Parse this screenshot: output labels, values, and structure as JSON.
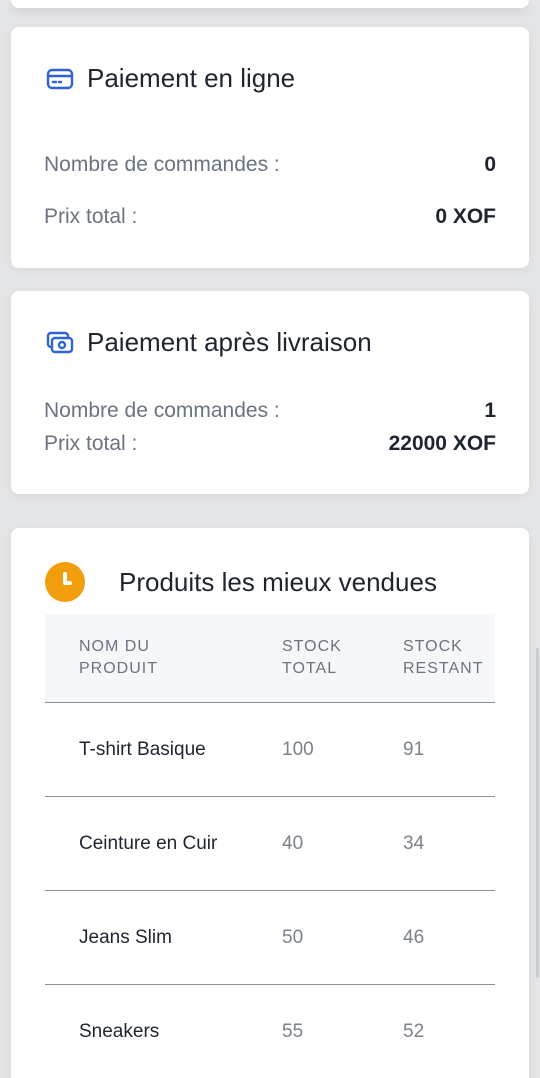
{
  "online_payment": {
    "title": "Paiement en ligne",
    "icon": "credit-card-icon",
    "orders_label": "Nombre de commandes :",
    "orders_value": "0",
    "total_label": "Prix total :",
    "total_value": "0 XOF"
  },
  "cod_payment": {
    "title": "Paiement après livraison",
    "icon": "cash-icon",
    "orders_label": "Nombre de commandes :",
    "orders_value": "1",
    "total_label": "Prix total :",
    "total_value": "22000 XOF"
  },
  "best_sellers": {
    "title": "Produits les mieux vendues",
    "icon": "clock-icon",
    "accent_color": "#f29d0c",
    "columns": [
      {
        "line1": "NOM DU",
        "line2": "PRODUIT"
      },
      {
        "line1": "STOCK",
        "line2": "TOTAL"
      },
      {
        "line1": "STOCK",
        "line2": "RESTANT"
      }
    ],
    "rows": [
      {
        "name": "T-shirt Basique",
        "stock_total": "100",
        "stock_remaining": "91"
      },
      {
        "name": "Ceinture en Cuir",
        "stock_total": "40",
        "stock_remaining": "34"
      },
      {
        "name": "Jeans Slim",
        "stock_total": "50",
        "stock_remaining": "46"
      },
      {
        "name": "Sneakers",
        "stock_total": "55",
        "stock_remaining": "52"
      }
    ]
  },
  "colors": {
    "primary_icon": "#2f63d6",
    "accent": "#f29d0c"
  }
}
